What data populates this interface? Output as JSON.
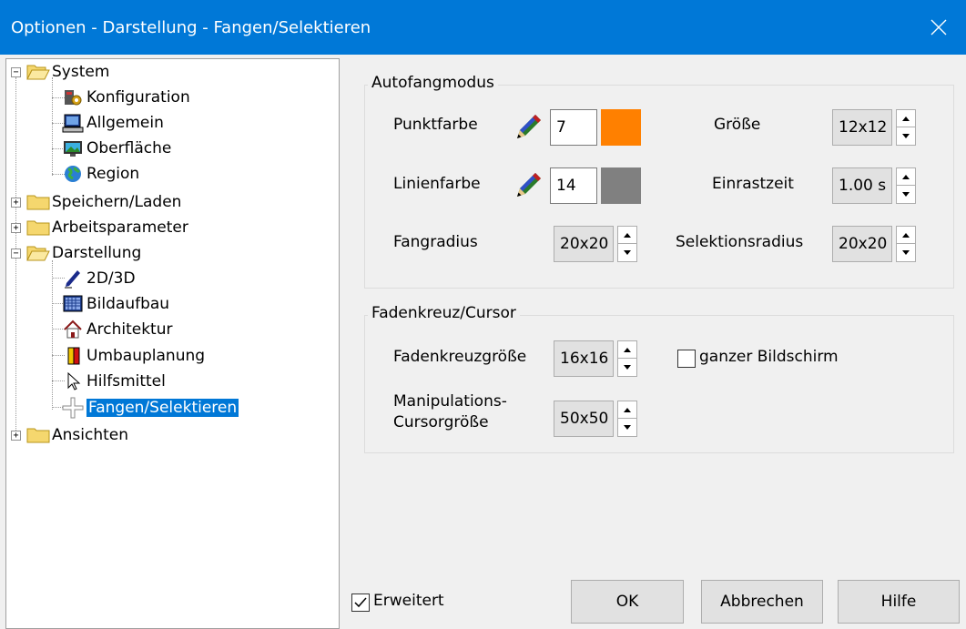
{
  "window": {
    "title": "Optionen - Darstellung - Fangen/Selektieren"
  },
  "tree": {
    "system": "System",
    "konfiguration": "Konfiguration",
    "allgemein": "Allgemein",
    "oberflaeche": "Oberfläche",
    "region": "Region",
    "speichern": "Speichern/Laden",
    "arbeitsparameter": "Arbeitsparameter",
    "darstellung": "Darstellung",
    "d2d3d": "2D/3D",
    "bildaufbau": "Bildaufbau",
    "architektur": "Architektur",
    "umbauplanung": "Umbauplanung",
    "hilfsmittel": "Hilfsmittel",
    "fangen": "Fangen/Selektieren",
    "ansichten": "Ansichten"
  },
  "autofang": {
    "group_label": "Autofangmodus",
    "punktfarbe_label": "Punktfarbe",
    "punktfarbe_value": "7",
    "punktfarbe_color": "#ff8000",
    "linienfarbe_label": "Linienfarbe",
    "linienfarbe_value": "14",
    "linienfarbe_color": "#808080",
    "fangradius_label": "Fangradius",
    "fangradius_value": "20x20",
    "groesse_label": "Größe",
    "groesse_value": "12x12",
    "einrastzeit_label": "Einrastzeit",
    "einrastzeit_value": "1.00 s",
    "selektionsradius_label": "Selektionsradius",
    "selektionsradius_value": "20x20"
  },
  "faden": {
    "group_label": "Fadenkreuz/Cursor",
    "fadenkreuz_label": "Fadenkreuzgröße",
    "fadenkreuz_value": "16x16",
    "ganzer_label": "ganzer Bildschirm",
    "manip_label_1": "Manipulations-",
    "manip_label_2": "Cursorgröße",
    "manip_value": "50x50"
  },
  "footer": {
    "erweitert": "Erweitert",
    "ok": "OK",
    "abbrechen": "Abbrechen",
    "hilfe": "Hilfe"
  },
  "colors": {
    "titlebar": "#0078d7",
    "selection": "#0078d7"
  }
}
